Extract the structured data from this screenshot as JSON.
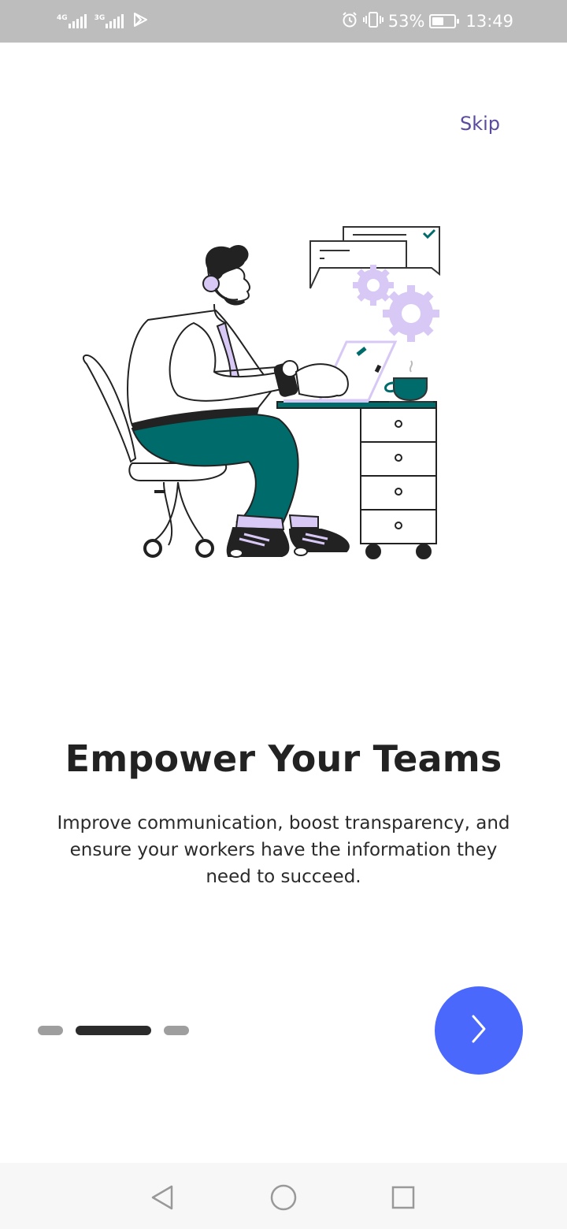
{
  "status_bar": {
    "network_1": "4G",
    "network_2": "3G",
    "battery_percent": "53%",
    "battery_level": 0.53,
    "time": "13:49",
    "icons": [
      "signal-icon",
      "signal-icon",
      "play-store-icon",
      "alarm-icon",
      "vibrate-icon",
      "battery-icon"
    ]
  },
  "onboarding": {
    "skip_label": "Skip",
    "title": "Empower Your Teams",
    "description": "Improve communication, boost transparency, and ensure your workers have the information they need to succeed.",
    "page_count": 3,
    "current_page": 2,
    "next_icon": "chevron-right-icon"
  },
  "colors": {
    "accent": "#4a68fc",
    "skip_text": "#5b4a9e",
    "illustration_teal": "#006b6b",
    "illustration_lavender": "#d7c8f5",
    "indicator_active": "#2b2b2b",
    "indicator_inactive": "#9e9e9e",
    "status_bar_bg": "#bdbdbd"
  },
  "nav_bar": {
    "icons": [
      "back-icon",
      "home-icon",
      "recents-icon"
    ]
  }
}
